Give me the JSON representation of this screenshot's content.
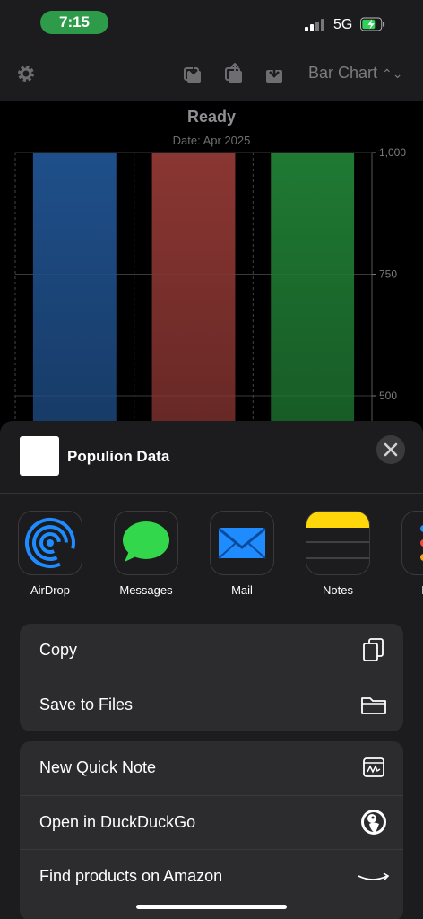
{
  "status_bar": {
    "time": "7:15",
    "carrier": "5G"
  },
  "toolbar": {
    "chart_type": "Bar Chart"
  },
  "chart": {
    "title": "Ready",
    "date": "Date: Apr 2025"
  },
  "chart_data": {
    "type": "bar",
    "categories": [
      "",
      "",
      ""
    ],
    "series": [
      {
        "values": [
          1000,
          1000,
          1000
        ]
      }
    ],
    "colors": [
      "#1f4f8a",
      "#8a3632",
      "#1f7a33"
    ],
    "title": "Ready",
    "subtitle": "Date: Apr 2025",
    "xlabel": "",
    "ylabel": "",
    "ylim": [
      500,
      1000
    ],
    "yticks": [
      "1,000",
      "750",
      "500"
    ],
    "grid": true
  },
  "share_sheet": {
    "title": "Populion Data",
    "apps": [
      {
        "label": "AirDrop",
        "icon": "airdrop-icon"
      },
      {
        "label": "Messages",
        "icon": "messages-icon"
      },
      {
        "label": "Mail",
        "icon": "mail-icon"
      },
      {
        "label": "Notes",
        "icon": "notes-icon"
      },
      {
        "label": "Rem",
        "icon": "reminders-icon"
      }
    ],
    "group1": [
      {
        "label": "Copy",
        "icon": "copy-icon"
      },
      {
        "label": "Save to Files",
        "icon": "folder-icon"
      }
    ],
    "group2": [
      {
        "label": "New Quick Note",
        "icon": "quick-note-icon"
      },
      {
        "label": "Open in DuckDuckGo",
        "icon": "duckduckgo-icon"
      },
      {
        "label": "Find products on Amazon",
        "icon": "amazon-icon"
      }
    ]
  },
  "colors": {
    "accent_green": "#2e9b4a",
    "sheet_bg": "#1c1c1e",
    "group_bg": "#2c2c2e"
  }
}
